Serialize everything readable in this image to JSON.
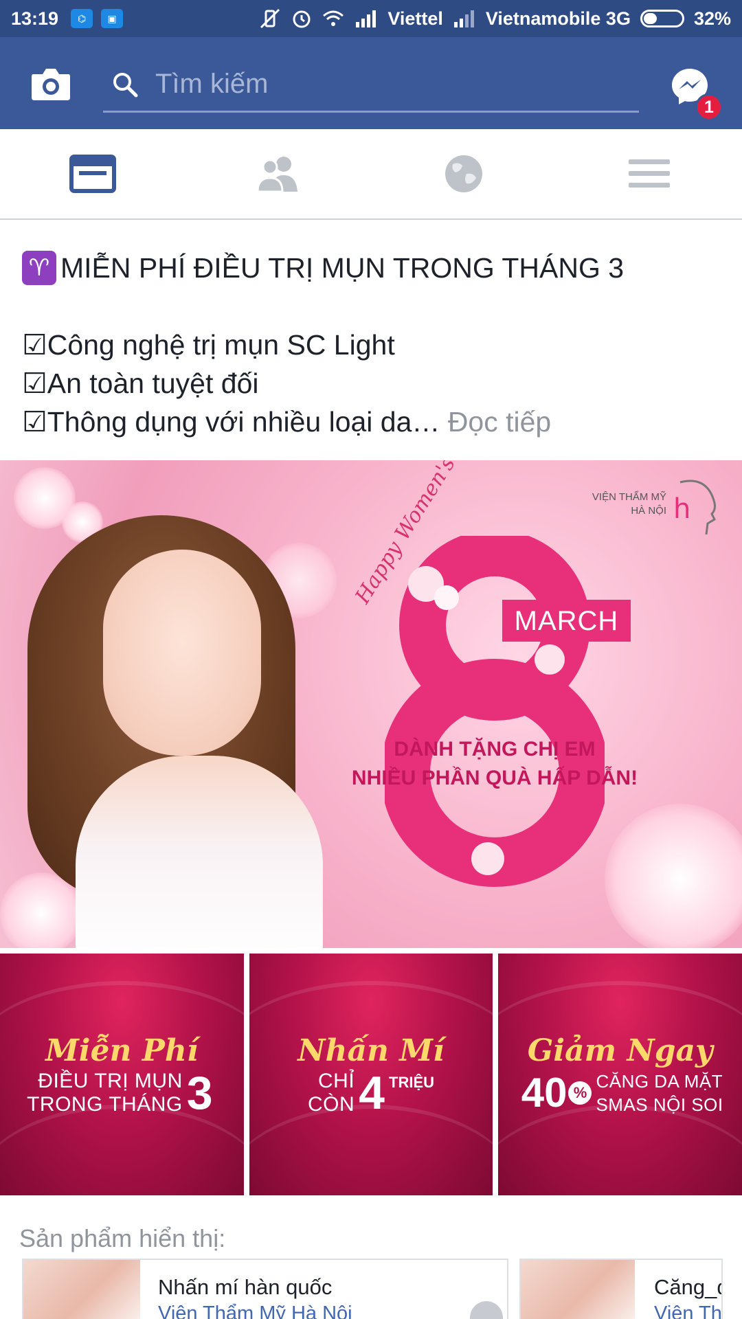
{
  "status_bar": {
    "time": "13:19",
    "carrier1": "Viettel",
    "carrier2": "Vietnamobile 3G",
    "battery": "32%",
    "battery_level": 0.32
  },
  "header": {
    "search_placeholder": "Tìm kiếm",
    "messenger_badge": "1",
    "colors": {
      "bar": "#3b5998",
      "status": "#2f4b83",
      "badge": "#e41e3f"
    }
  },
  "tabs": [
    {
      "icon": "news-feed-icon",
      "active": true
    },
    {
      "icon": "friends-icon",
      "active": false
    },
    {
      "icon": "globe-icon",
      "active": false
    },
    {
      "icon": "menu-icon",
      "active": false
    }
  ],
  "post": {
    "headline": "MIỄN PHÍ ĐIỀU TRỊ MỤN TRONG THÁNG 3",
    "bullet1": "☑Công nghệ trị mụn SC Light",
    "bullet2": "☑An toàn tuyệt đối",
    "bullet3": "☑Thông dụng với nhiều loại da…",
    "read_more": "Đọc tiếp"
  },
  "hero": {
    "brand_line1": "VIỆN THẨM MỸ",
    "brand_line2": "HÀ NỘI",
    "happy": "Happy Women's",
    "march": "MARCH",
    "promo_line1": "DÀNH TẶNG CHỊ EM",
    "promo_line2": "NHIỀU PHẦN QUÀ HẤP DẪN!"
  },
  "tiles": [
    {
      "script": "Miễn Phí",
      "line1": "ĐIỀU TRỊ MỤN",
      "line2": "TRONG THÁNG",
      "number": "3"
    },
    {
      "script": "Nhấn Mí",
      "line1": "CHỈ",
      "line2": "CÒN",
      "number": "4",
      "unit": "TRIỆU"
    },
    {
      "script": "Giảm Ngay",
      "number": "40",
      "percent": "%",
      "line1": "CĂNG DA MẶT",
      "line2": "SMAS NỘI SOI"
    }
  ],
  "products": {
    "label": "Sản phẩm hiển thị:",
    "items": [
      {
        "title": "Nhấn mí hàn quốc",
        "subtitle": "Viện Thẩm Mỹ Hà Nội"
      },
      {
        "title": "Căng_d",
        "subtitle": "Viện Th"
      }
    ]
  }
}
